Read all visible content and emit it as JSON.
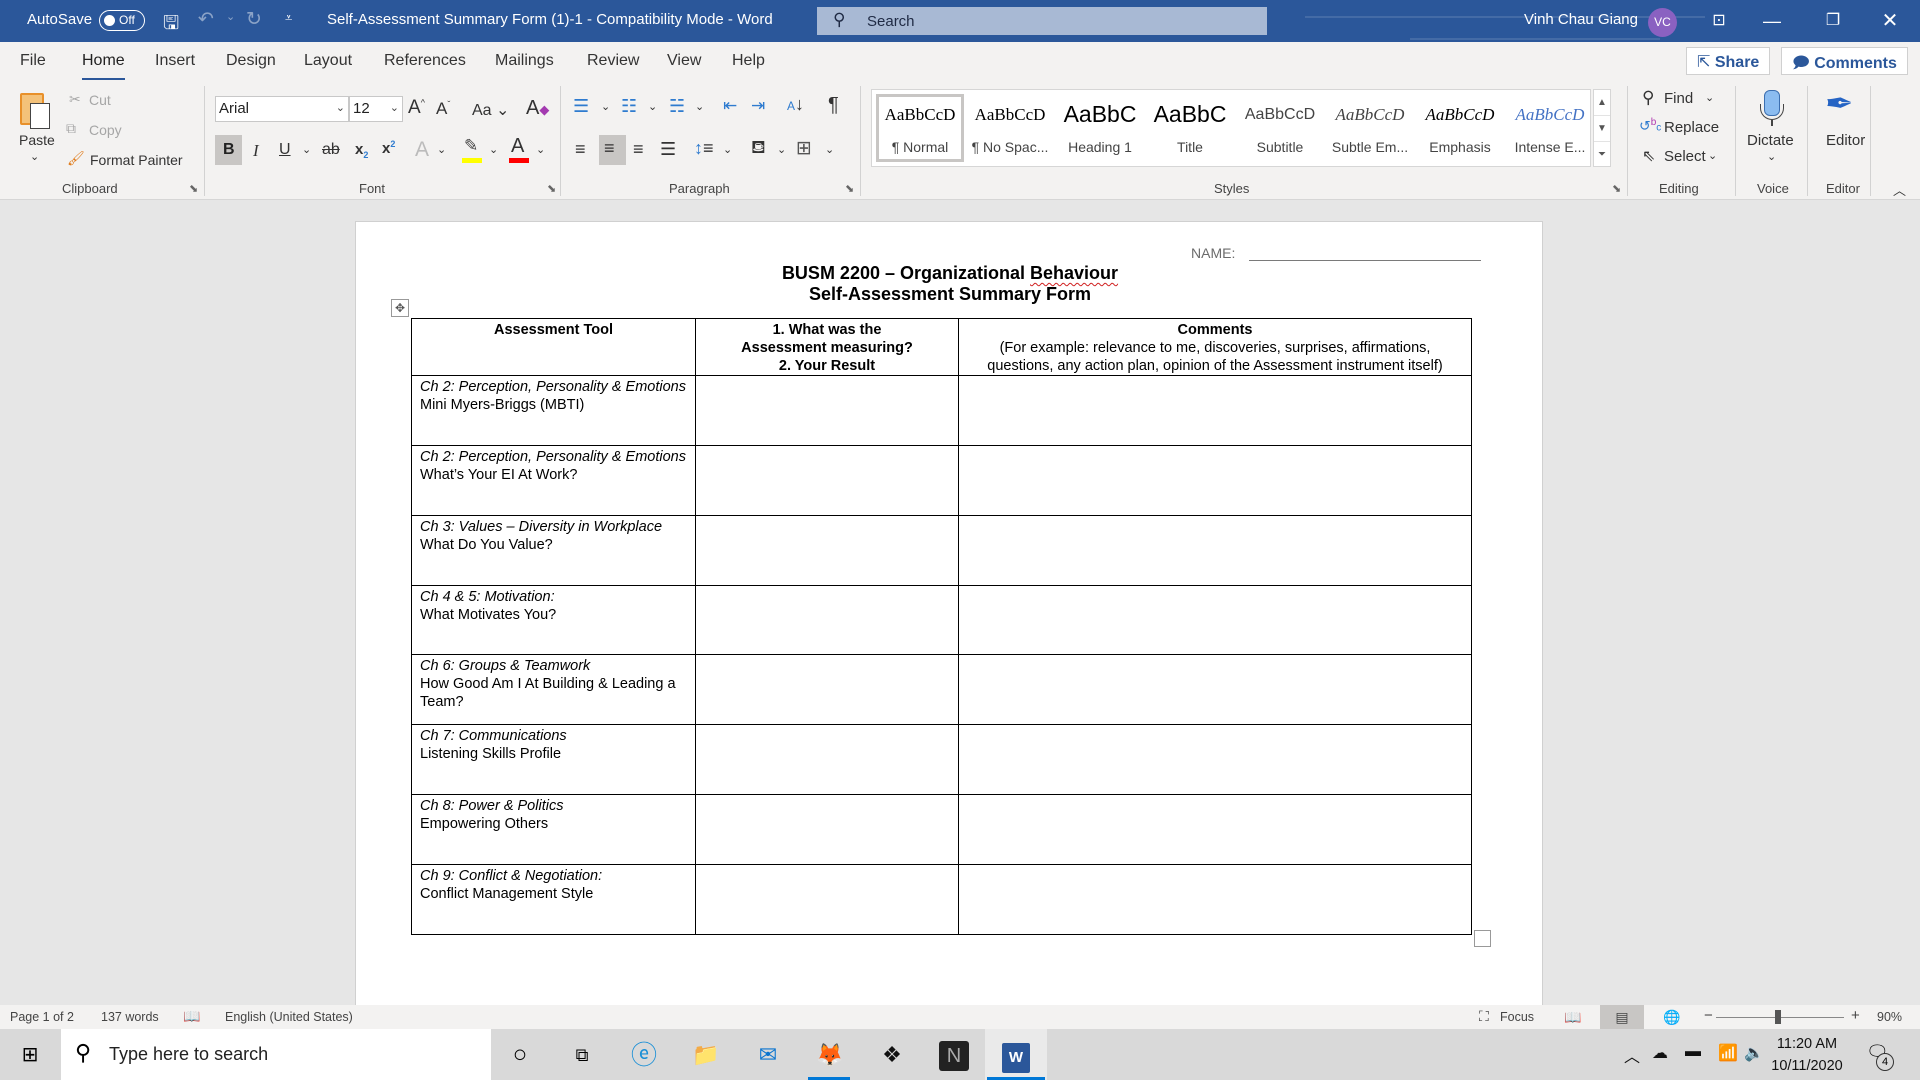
{
  "titlebar": {
    "autosave_label": "AutoSave",
    "autosave_state": "Off",
    "document_title": "Self-Assessment Summary Form (1)-1  -  Compatibility Mode  -  Word",
    "search_placeholder": "Search",
    "user_name": "Vinh Chau Giang",
    "user_initials": "VC",
    "accent_color": "#2b579a"
  },
  "tabs": [
    {
      "label": "File"
    },
    {
      "label": "Home",
      "active": true
    },
    {
      "label": "Insert"
    },
    {
      "label": "Design"
    },
    {
      "label": "Layout"
    },
    {
      "label": "References"
    },
    {
      "label": "Mailings"
    },
    {
      "label": "Review"
    },
    {
      "label": "View"
    },
    {
      "label": "Help"
    }
  ],
  "top_actions": {
    "share": "Share",
    "comments": "Comments"
  },
  "ribbon": {
    "clipboard": {
      "label": "Clipboard",
      "paste": "Paste",
      "cut": "Cut",
      "copy": "Copy",
      "format_painter": "Format Painter"
    },
    "font": {
      "label": "Font",
      "font_name": "Arial",
      "font_size": "12",
      "change_case": "Aa",
      "bold": "B",
      "italic": "I",
      "underline": "U",
      "strikethrough": "ab"
    },
    "paragraph": {
      "label": "Paragraph"
    },
    "styles": {
      "label": "Styles",
      "items": [
        {
          "preview": "AaBbCcD",
          "name": "¶ Normal",
          "selected": true
        },
        {
          "preview": "AaBbCcD",
          "name": "¶ No Spac..."
        },
        {
          "preview": "AaBbC",
          "name": "Heading 1"
        },
        {
          "preview": "AaBbC",
          "name": "Title"
        },
        {
          "preview": "AaBbCcD",
          "name": "Subtitle"
        },
        {
          "preview": "AaBbCcD",
          "name": "Subtle Em..."
        },
        {
          "preview": "AaBbCcD",
          "name": "Emphasis"
        },
        {
          "preview": "AaBbCcD",
          "name": "Intense E..."
        }
      ]
    },
    "editing": {
      "label": "Editing",
      "find": "Find",
      "replace": "Replace",
      "select": "Select"
    },
    "voice": {
      "label": "Voice",
      "dictate": "Dictate"
    },
    "editor": {
      "label": "Editor",
      "editor": "Editor"
    }
  },
  "document": {
    "name_label": "NAME:",
    "title_line1_prefix": "BUSM 2200 – Organizational ",
    "title_line1_misspelled": "Behaviour",
    "title_line2": "Self-Assessment Summary Form",
    "table": {
      "headers": {
        "col1": "Assessment Tool",
        "col2_line1": "1.   What was the",
        "col2_line2": "Assessment measuring?",
        "col2_line3": "2. Your Result",
        "col3_title": "Comments",
        "col3_sub": "(For example: relevance to me, discoveries, surprises, affirmations, questions, any action plan, opinion of the Assessment instrument itself)"
      },
      "rows": [
        {
          "chapter": "Ch 2: Perception, Personality & Emotions",
          "tool": "Mini Myers-Briggs (MBTI)",
          "result": "",
          "comments": ""
        },
        {
          "chapter": "Ch 2: Perception, Personality & Emotions",
          "tool": "What’s Your EI At Work?",
          "result": "",
          "comments": ""
        },
        {
          "chapter": "Ch 3: Values – Diversity in Workplace",
          "tool": "What Do You Value?",
          "result": "",
          "comments": ""
        },
        {
          "chapter": "Ch 4 & 5: Motivation:",
          "tool": "What Motivates You?",
          "result": "",
          "comments": ""
        },
        {
          "chapter": "Ch 6:  Groups & Teamwork",
          "tool": "How Good Am I At Building & Leading a Team?",
          "result": "",
          "comments": ""
        },
        {
          "chapter": "Ch 7: Communications",
          "tool": "Listening Skills Profile",
          "result": "",
          "comments": ""
        },
        {
          "chapter": "Ch 8: Power & Politics",
          "tool": "Empowering Others",
          "result": "",
          "comments": ""
        },
        {
          "chapter": "Ch 9: Conflict & Negotiation:",
          "tool": "Conflict Management Style",
          "result": "",
          "comments": ""
        }
      ]
    }
  },
  "statusbar": {
    "page": "Page 1 of 2",
    "words": "137 words",
    "language": "English (United States)",
    "focus": "Focus",
    "zoom_level": "90%",
    "zoom_percent": 90
  },
  "taskbar": {
    "search_placeholder": "Type here to search",
    "time": "11:20 AM",
    "date": "10/11/2020",
    "notification_count": "4"
  }
}
